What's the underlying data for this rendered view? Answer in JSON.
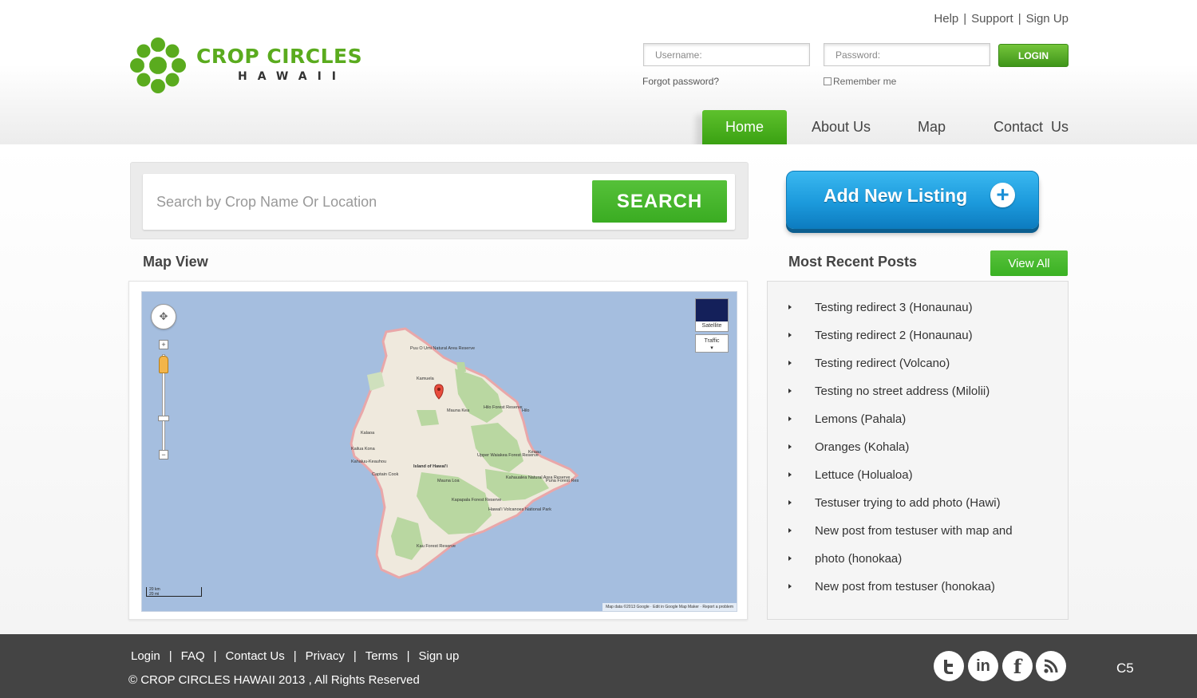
{
  "brand": {
    "name": "CROP CIRCLES",
    "sub": "HAWAII",
    "green": "#5aab1e"
  },
  "top_links": [
    "Help",
    "Support",
    "Sign Up"
  ],
  "login": {
    "username_placeholder": "Username:",
    "password_placeholder": "Password:",
    "button_label": "LOGIN",
    "forgot_label": "Forgot password?",
    "remember_label": "Remember me"
  },
  "nav": {
    "items": [
      {
        "label": "Home",
        "active": true
      },
      {
        "label": "About Us",
        "active": false
      },
      {
        "label": "Map",
        "active": false
      },
      {
        "label": "Contact  Us",
        "active": false
      }
    ]
  },
  "search": {
    "placeholder": "Search by Crop Name Or Location",
    "button_label": "SEARCH"
  },
  "add_listing": {
    "label": "Add New Listing"
  },
  "map_section": {
    "title": "Map View",
    "satellite_label": "Satellite",
    "traffic_label": "Traffic",
    "scale_km": "20 km",
    "scale_mi": "20 mi",
    "footer_text": "Map data ©2013 Google · Edit in Google Map Maker · Report a problem",
    "places": [
      "Puu O Umi Natural Area Reserve",
      "Kamuela",
      "Mauna Kea",
      "Hilo Forest Reserve",
      "Hilo",
      "Kalaoa",
      "Kailua Kona",
      "Kahaluu-Keauhou",
      "Captain Cook",
      "Island of Hawai'i",
      "Mauna Loa",
      "Upper Waiakea Forest Reserve",
      "Keaau",
      "Kahaualea Natural Area Reserve",
      "Puna Forest Res",
      "Kapapala Forest Reserve",
      "Hawai'i Volcanoes National Park",
      "Kau Forest Reserve"
    ]
  },
  "recent_posts": {
    "title": "Most Recent Posts",
    "view_all_label": "View All",
    "items": [
      "Testing redirect 3 (Honaunau)",
      "Testing redirect 2 (Honaunau)",
      "Testing redirect (Volcano)",
      "Testing no street address (Milolii)",
      "Lemons (Pahala)",
      "Oranges (Kohala)",
      "Lettuce (Holualoa)",
      "Testuser trying to add photo (Hawi)",
      "New post from testuser with map and",
      "photo (honokaa)",
      "New post from testuser (honokaa)"
    ]
  },
  "footer": {
    "links": [
      "Login",
      "FAQ",
      "Contact Us",
      "Privacy",
      "Terms",
      "Sign up"
    ],
    "copyright": "© CROP CIRCLES HAWAII 2013 , All Rights Reserved",
    "social_icons": [
      "twitter-icon",
      "linkedin-icon",
      "facebook-icon",
      "rss-icon"
    ],
    "page_code": "C5"
  }
}
